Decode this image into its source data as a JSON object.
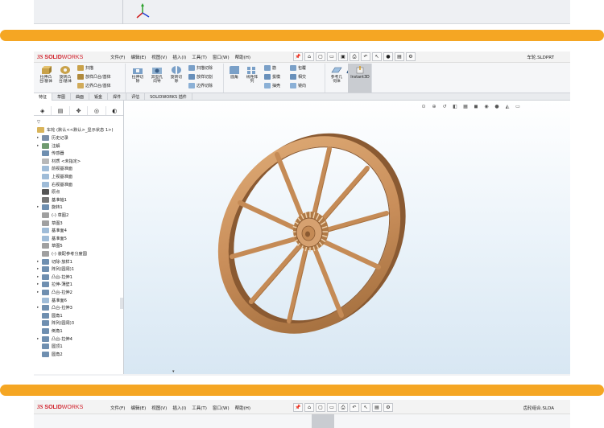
{
  "top_window": {
    "has_triad": true
  },
  "app": {
    "logo": {
      "ds": "3S",
      "solid": "SOLID",
      "works": "WORKS"
    },
    "menus": [
      "文件(F)",
      "编辑(E)",
      "视图(V)",
      "插入(I)",
      "工具(T)",
      "窗口(W)",
      "帮助(H)"
    ],
    "filename": "车轮.SLDPRT",
    "ribbon": {
      "boss_extrude": "拉伸凸\n台/基体",
      "boss_revolve": "旋转凸\n台/基体",
      "sweep": "扫描",
      "loft": "放样凸台/基体",
      "boundary": "边界凸台/基体",
      "cut_extrude": "拉伸切\n除",
      "hole_wizard": "异型孔\n向导",
      "cut_revolve": "旋转切\n除",
      "swept_cut": "扫描切除",
      "lofted_cut": "放样切割",
      "boundary_cut": "边界切除",
      "fillet": "圆角",
      "linear_pattern": "线性阵\n列",
      "rib": "筋",
      "draft": "拔模",
      "shell": "抽壳",
      "wrap": "包覆",
      "intersect": "相交",
      "mirror": "镜向",
      "ref_geometry": "参考几\n何体",
      "curves": "曲线",
      "instant3d": "Instant3D"
    },
    "tabs": [
      "特征",
      "草图",
      "曲面",
      "钣金",
      "焊件",
      "评估",
      "SOLIDWORKS 插件"
    ],
    "tree": {
      "root": "车轮  (默认<<默认>_显示状态 1>)",
      "items": [
        "历史记录",
        "注解",
        "传感器",
        "材质 <未指定>",
        "前视基准面",
        "上视基准面",
        "右视基准面",
        "原点",
        "基准轴1",
        "旋转1",
        "(-) 草图2",
        "草图3",
        "基准面4",
        "基准面5",
        "草图5",
        "(-) 装配参考分度圆",
        "切除-放样1",
        "阵列(圆周)1",
        "凸台-拉伸1",
        "拉伸-薄壁1",
        "凸台-拉伸2",
        "基准面6",
        "凸台-拉伸3",
        "圆角1",
        "阵列(圆周)3",
        "倒角1",
        "凸台-拉伸4",
        "圆顶1",
        "圆角2"
      ]
    }
  },
  "bottom_app": {
    "logo": {
      "ds": "3S",
      "solid": "SOLID",
      "works": "WORKS"
    },
    "menus": [
      "文件(F)",
      "编辑(E)",
      "视图(V)",
      "插入(I)",
      "工具(T)",
      "窗口(W)",
      "帮助(H)"
    ],
    "filename": "齿轮组合.SLDA"
  },
  "colors": {
    "orange_band": "#f5a623",
    "wheel_wood": "#c98e5a",
    "wheel_dark": "#8a5a32",
    "sw_red": "#d0202a"
  }
}
